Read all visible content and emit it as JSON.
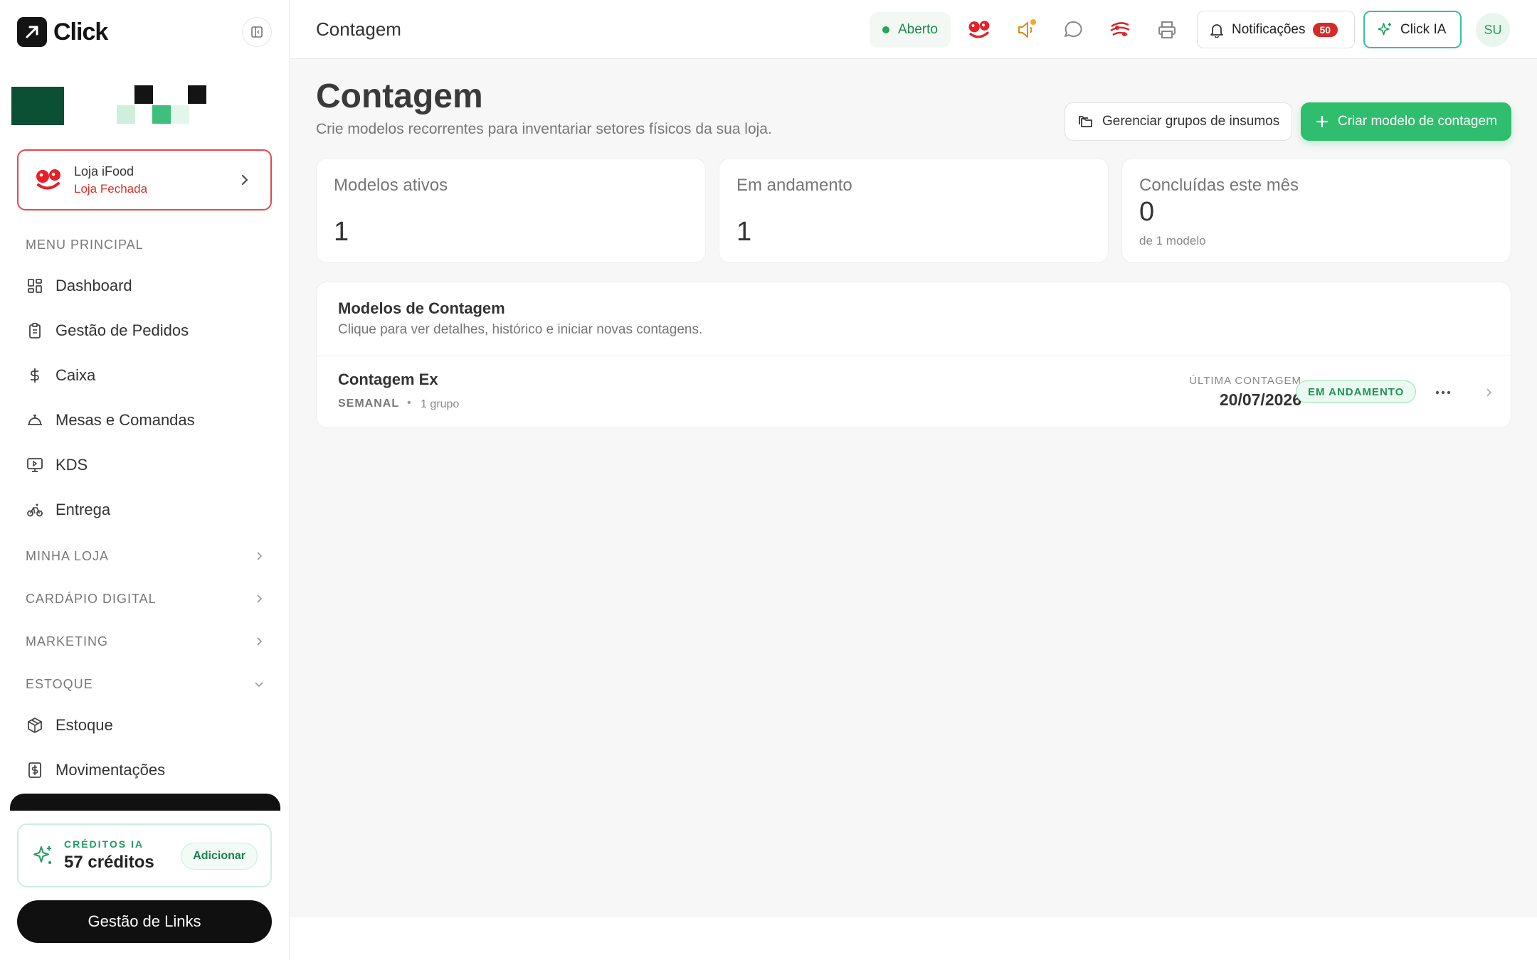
{
  "app": {
    "logo_text": "Click",
    "brand_colors": {
      "accent": "#2fbd6e",
      "danger": "#d93025",
      "dark": "#101010"
    }
  },
  "sidebar": {
    "store": {
      "name": "Loja iFood",
      "status": "Loja Fechada",
      "icon": "ifood-icon"
    },
    "main_menu_label": "MENU PRINCIPAL",
    "main_items": [
      {
        "label": "Dashboard",
        "icon": "dashboard-icon"
      },
      {
        "label": "Gestão de Pedidos",
        "icon": "clipboard-icon"
      },
      {
        "label": "Caixa",
        "icon": "dollar-icon"
      },
      {
        "label": "Mesas e Comandas",
        "icon": "cloche-icon"
      },
      {
        "label": "KDS",
        "icon": "monitor-play-icon"
      },
      {
        "label": "Entrega",
        "icon": "bike-icon"
      }
    ],
    "sections": [
      {
        "label": "MINHA LOJA",
        "state": "collapsed"
      },
      {
        "label": "CARDÁPIO DIGITAL",
        "state": "collapsed"
      },
      {
        "label": "MARKETING",
        "state": "collapsed"
      },
      {
        "label": "ESTOQUE",
        "state": "expanded"
      }
    ],
    "stock_items": [
      {
        "label": "Estoque",
        "icon": "box-icon"
      },
      {
        "label": "Movimentações",
        "icon": "receipt-dollar-icon"
      }
    ],
    "credits": {
      "label": "CRÉDITOS IA",
      "value": "57 créditos",
      "add_label": "Adicionar"
    },
    "links_button": "Gestão de Links"
  },
  "topbar": {
    "title": "Contagem",
    "status": "Aberto",
    "notifications_label": "Notificações",
    "notifications_count": "50",
    "ia_label": "Click IA",
    "avatar_initials": "SU"
  },
  "main": {
    "title": "Contagem",
    "subtitle": "Crie modelos recorrentes para inventariar setores físicos da sua loja.",
    "manage_button": "Gerenciar grupos de insumos",
    "create_button": "Criar modelo de contagem",
    "stats": [
      {
        "label": "Modelos ativos",
        "value": "1",
        "sub": ""
      },
      {
        "label": "Em andamento",
        "value": "1",
        "sub": ""
      },
      {
        "label": "Concluídas este mês",
        "value": "0",
        "sub": "de 1 modelo"
      }
    ],
    "models_panel": {
      "title": "Modelos de Contagem",
      "description": "Clique para ver detalhes, histórico e iniciar novas contagens.",
      "rows": [
        {
          "name": "Contagem Ex",
          "frequency": "SEMANAL",
          "groups": "1 grupo",
          "last_label": "ÚLTIMA CONTAGEM",
          "last_date": "20/07/2026",
          "status": "EM ANDAMENTO"
        }
      ]
    }
  }
}
